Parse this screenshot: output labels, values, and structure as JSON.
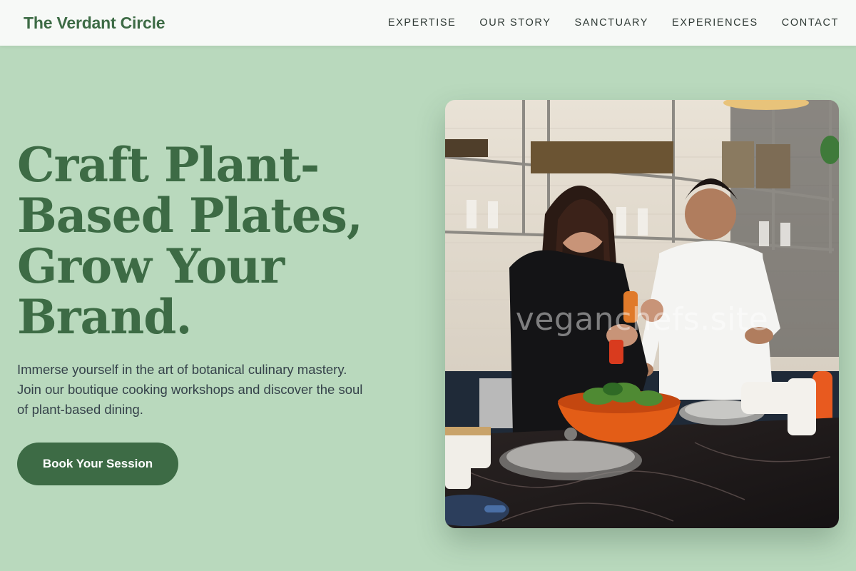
{
  "header": {
    "brand": "The Verdant Circle",
    "nav": [
      {
        "label": "EXPERTISE"
      },
      {
        "label": "OUR STORY"
      },
      {
        "label": "SANCTUARY"
      },
      {
        "label": "EXPERIENCES"
      },
      {
        "label": "CONTACT"
      }
    ]
  },
  "hero": {
    "title_lines": [
      "Craft Plant-",
      "Based Plates,",
      "Grow Your",
      "Brand."
    ],
    "subtitle": "Immerse yourself in the art of botanical culinary mastery. Join our boutique cooking workshops and discover the soul of plant-based dining.",
    "cta_label": "Book Your Session",
    "image": {
      "watermark": "veganchefs.site"
    }
  },
  "colors": {
    "background": "#b9d9bd",
    "brand_green": "#3d6b45",
    "nav_background": "#f7f9f7",
    "body_text": "#35424a"
  }
}
